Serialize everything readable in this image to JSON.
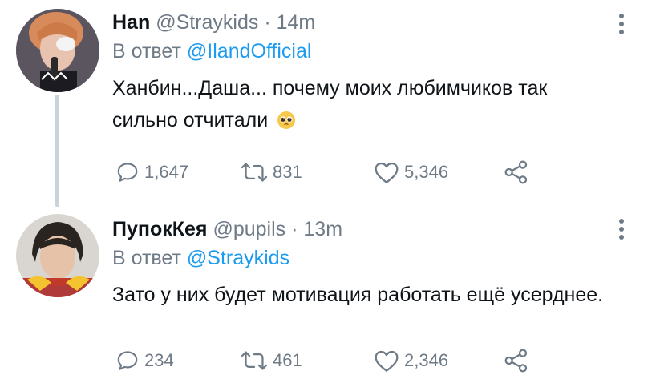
{
  "tweets": [
    {
      "display_name": "Han",
      "handle": "@Straykids",
      "separator": " · ",
      "time": "14m",
      "reply_prefix": "В ответ ",
      "reply_to": "@IlandOfficial",
      "text": "Ханбин...Даша... почему моих любимчиков так сильно отчитали",
      "emoji": "pleading-face",
      "replies": "1,647",
      "retweets": "831",
      "likes": "5,346"
    },
    {
      "display_name": "ПупокКея",
      "handle": "@pupils",
      "separator": " · ",
      "time": "13m",
      "reply_prefix": "В ответ ",
      "reply_to": "@Straykids",
      "text": "Зато у них будет мотивация работать ещё усерднее.",
      "replies": "234",
      "retweets": "461",
      "likes": "2,346"
    }
  ],
  "colors": {
    "text": "#0f1419",
    "secondary": "#6e7a86",
    "link": "#1d9bf0",
    "thread_line": "#c9d3db"
  },
  "icons": [
    "reply-icon",
    "retweet-icon",
    "like-icon",
    "share-icon",
    "more-icon"
  ]
}
